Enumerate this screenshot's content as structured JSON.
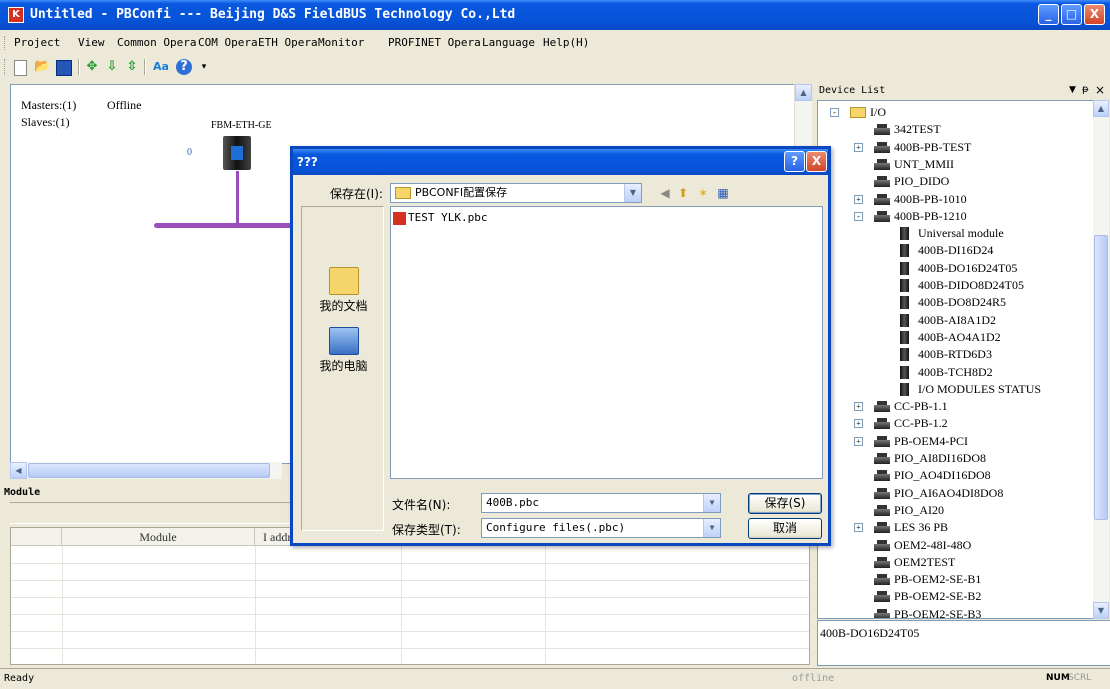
{
  "window": {
    "title": "Untitled - PBConfi --- Beijing D&S FieldBUS Technology Co.,Ltd",
    "app_icon_text": "K",
    "controls": {
      "minimize": "_",
      "maximize": "□",
      "close": "X"
    }
  },
  "menu": [
    "Project",
    "View",
    "Common Opera",
    "COM Opera",
    "ETH Opera",
    "Monitor",
    "PROFINET Opera",
    "Language",
    "Help(H)"
  ],
  "toolbar": {
    "icons": [
      "new-icon",
      "open-icon",
      "save-icon",
      "add-icon",
      "move-down-icon",
      "move-updown-icon",
      "font-icon",
      "help-icon"
    ],
    "font_icon_text": "Aa",
    "help_icon_text": "?"
  },
  "canvas": {
    "masters": "Masters:(1)",
    "status": "Offline",
    "slaves": "Slaves:(1)",
    "device_label": "FBM-ETH-GE",
    "device_index": "0"
  },
  "module_panel": {
    "title": "Module",
    "columns": [
      "",
      "Module",
      "I addr",
      "",
      "",
      ""
    ]
  },
  "statusbar": {
    "ready": "Ready",
    "mode": "offline",
    "num": "NUM",
    "scrl": "SCRL"
  },
  "device_list": {
    "title": "Device List",
    "header_icons": [
      "▼",
      "ᵽ",
      "×"
    ],
    "items": [
      {
        "label": "I/O",
        "type": "folder",
        "level": 0,
        "expand": "-"
      },
      {
        "label": "342TEST",
        "type": "device",
        "level": 1,
        "expand": ""
      },
      {
        "label": "400B-PB-TEST",
        "type": "device",
        "level": 1,
        "expand": "+"
      },
      {
        "label": "UNT_MMII",
        "type": "device",
        "level": 1,
        "expand": ""
      },
      {
        "label": "PIO_DIDO",
        "type": "device",
        "level": 1,
        "expand": ""
      },
      {
        "label": "400B-PB-1010",
        "type": "device",
        "level": 1,
        "expand": "+"
      },
      {
        "label": "400B-PB-1210",
        "type": "device",
        "level": 1,
        "expand": "-"
      },
      {
        "label": "Universal module",
        "type": "module",
        "level": 2,
        "expand": ""
      },
      {
        "label": "400B-DI16D24",
        "type": "module",
        "level": 2,
        "expand": ""
      },
      {
        "label": "400B-DO16D24T05",
        "type": "module",
        "level": 2,
        "expand": ""
      },
      {
        "label": "400B-DIDO8D24T05",
        "type": "module",
        "level": 2,
        "expand": ""
      },
      {
        "label": "400B-DO8D24R5",
        "type": "module",
        "level": 2,
        "expand": ""
      },
      {
        "label": "400B-AI8A1D2",
        "type": "module",
        "level": 2,
        "expand": ""
      },
      {
        "label": "400B-AO4A1D2",
        "type": "module",
        "level": 2,
        "expand": ""
      },
      {
        "label": "400B-RTD6D3",
        "type": "module",
        "level": 2,
        "expand": ""
      },
      {
        "label": "400B-TCH8D2",
        "type": "module",
        "level": 2,
        "expand": ""
      },
      {
        "label": "I/O MODULES STATUS",
        "type": "module",
        "level": 2,
        "expand": ""
      },
      {
        "label": "CC-PB-1.1",
        "type": "device",
        "level": 1,
        "expand": "+"
      },
      {
        "label": "CC-PB-1.2",
        "type": "device",
        "level": 1,
        "expand": "+"
      },
      {
        "label": "PB-OEM4-PCI",
        "type": "device",
        "level": 1,
        "expand": "+"
      },
      {
        "label": "PIO_AI8DI16DO8",
        "type": "device",
        "level": 1,
        "expand": ""
      },
      {
        "label": "PIO_AO4DI16DO8",
        "type": "device",
        "level": 1,
        "expand": ""
      },
      {
        "label": "PIO_AI6AO4DI8DO8",
        "type": "device",
        "level": 1,
        "expand": ""
      },
      {
        "label": "PIO_AI20",
        "type": "device",
        "level": 1,
        "expand": ""
      },
      {
        "label": "LES 36 PB",
        "type": "device",
        "level": 1,
        "expand": "+"
      },
      {
        "label": "OEM2-48I-48O",
        "type": "device",
        "level": 1,
        "expand": ""
      },
      {
        "label": "OEM2TEST",
        "type": "device",
        "level": 1,
        "expand": ""
      },
      {
        "label": "PB-OEM2-SE-B1",
        "type": "device",
        "level": 1,
        "expand": ""
      },
      {
        "label": "PB-OEM2-SE-B2",
        "type": "device",
        "level": 1,
        "expand": ""
      },
      {
        "label": "PB-OEM2-SE-B3",
        "type": "device",
        "level": 1,
        "expand": ""
      }
    ],
    "selected_info": "400B-DO16D24T05"
  },
  "dialog": {
    "title": "???",
    "help_btn": "?",
    "close_btn": "X",
    "save_in_label": "保存在(I):",
    "save_in_value": "PBCONFI配置保存",
    "files": [
      {
        "name": "TEST YLK.pbc"
      }
    ],
    "places": [
      {
        "label": "我的文档",
        "icon": "my-documents-icon"
      },
      {
        "label": "我的电脑",
        "icon": "my-computer-icon"
      }
    ],
    "filename_label": "文件名(N):",
    "filename_value": "400B.pbc",
    "filetype_label": "保存类型(T):",
    "filetype_value": "Configure files(.pbc)",
    "save_button": "保存(S)",
    "cancel_button": "取消"
  },
  "colors": {
    "titlebar": "#0653d8",
    "bus_line": "#9b4fbf",
    "panel": "#ece9d8"
  }
}
